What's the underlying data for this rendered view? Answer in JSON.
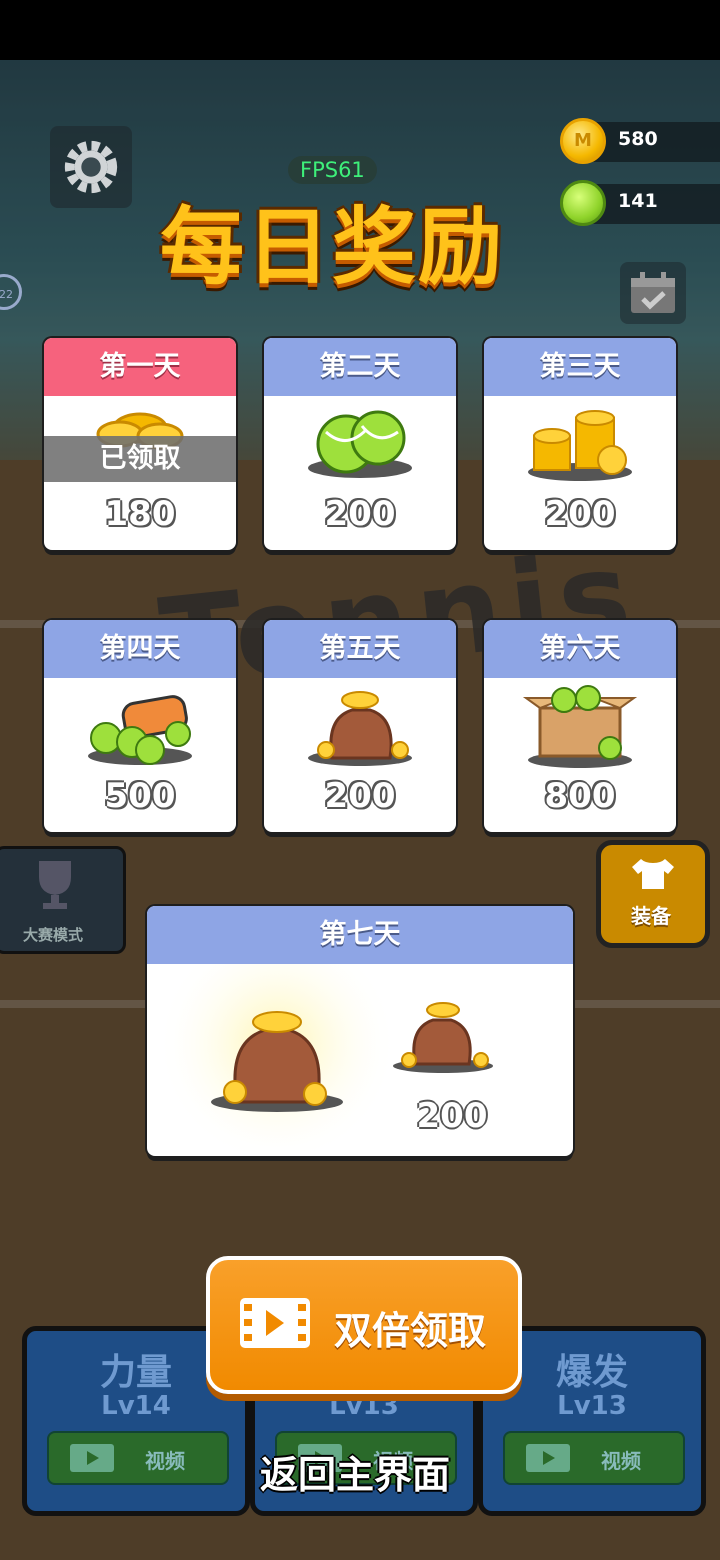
{
  "hud": {
    "fps": "FPS61",
    "coins": "580",
    "balls": "141",
    "side_badge": "22"
  },
  "title": "每日奖励",
  "background_logo": "Tennis",
  "days": [
    {
      "label": "第一天",
      "amount": "180",
      "reward": "coins",
      "status": "已领取"
    },
    {
      "label": "第二天",
      "amount": "200",
      "reward": "tennis-balls"
    },
    {
      "label": "第三天",
      "amount": "200",
      "reward": "coin-stack"
    },
    {
      "label": "第四天",
      "amount": "500",
      "reward": "ball-tube"
    },
    {
      "label": "第五天",
      "amount": "200",
      "reward": "coin-bag"
    },
    {
      "label": "第六天",
      "amount": "800",
      "reward": "ball-box"
    },
    {
      "label": "第七天",
      "amount": "200",
      "reward": "big-coin-bag"
    }
  ],
  "side_buttons": {
    "tournament": "大赛模式",
    "equip": "装备"
  },
  "upgrades": [
    {
      "name": "力量",
      "level": "Lv14",
      "video": "视频"
    },
    {
      "name": "",
      "level": "Lv13",
      "video": "视频"
    },
    {
      "name": "爆发",
      "level": "Lv13",
      "video": "视频"
    }
  ],
  "actions": {
    "double_claim": "双倍领取",
    "return_main": "返回主界面"
  },
  "colors": {
    "claimed_header": "#f6627d",
    "day_header": "#8ea5e5",
    "title": "#ffc21a",
    "double_button": "#f18a00",
    "fps": "#3ef07a"
  }
}
